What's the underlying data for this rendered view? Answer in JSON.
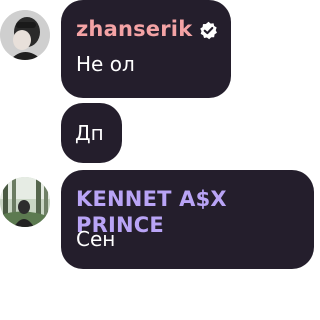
{
  "colors": {
    "bubble": "#241e2c",
    "message_text": "#ffffff",
    "author_zhanserik": "#f4a3a5",
    "author_kennet": "#b9a4f6"
  },
  "messages": [
    {
      "author": "zhanserik",
      "verified": true,
      "badge_icon": "verified-badge-icon",
      "avatar": "avatar-dark-portrait",
      "text": "Не ол"
    },
    {
      "author": "",
      "text": "Дп"
    },
    {
      "author": "KENNET A$X PRINCE",
      "verified": false,
      "avatar": "avatar-forest-portrait",
      "text": "Сен"
    }
  ]
}
